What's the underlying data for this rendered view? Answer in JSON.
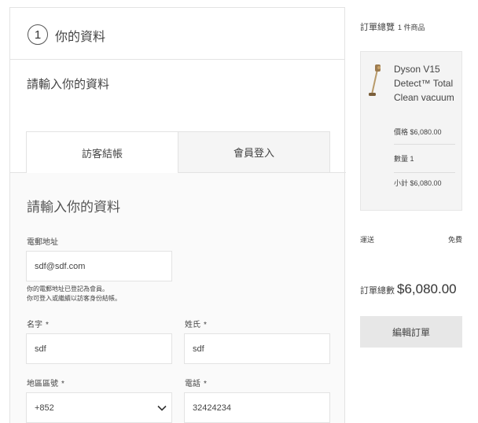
{
  "step": {
    "number": "1",
    "title": "你的資料"
  },
  "intro": {
    "text": "請輸入你的資料"
  },
  "tabs": [
    {
      "label": "訪客結帳",
      "active": true
    },
    {
      "label": "會員登入",
      "active": false
    }
  ],
  "form": {
    "title": "請輸入你的資料",
    "email": {
      "label": "電郵地址",
      "value": "sdf@sdf.com"
    },
    "hint_line1": "你的電郵地址已登記為會員。",
    "hint_line2": "你可登入或繼續以訪客身份結帳。",
    "first_name": {
      "label": "名字",
      "required": "*",
      "value": "sdf"
    },
    "last_name": {
      "label": "姓氏",
      "required": "*",
      "value": "sdf"
    },
    "area_code": {
      "label": "地區區號",
      "required": "*",
      "value": "+852"
    },
    "phone": {
      "label": "電話",
      "required": "*",
      "value": "32424234"
    }
  },
  "summary": {
    "title": "訂單總覽",
    "count": "1 件商品",
    "product": {
      "name": "Dyson V15 Detect™ Total Clean vacuum",
      "price": "價格 $6,080.00",
      "qty": "數量 1",
      "subtotal": "小計 $6,080.00"
    },
    "shipping_label": "運送",
    "shipping_value": "免費",
    "total_label": "訂單總數",
    "total_value": "$6,080.00",
    "edit_button": "編輯訂單"
  }
}
